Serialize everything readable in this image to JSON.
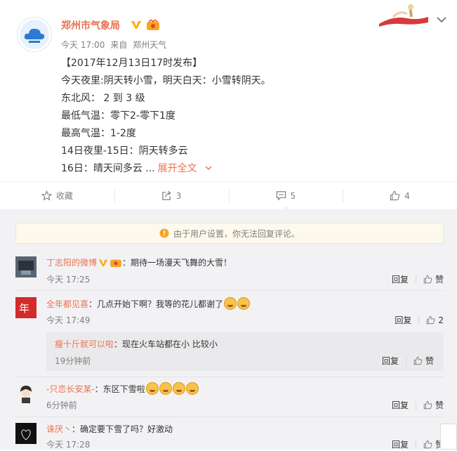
{
  "post": {
    "author": "郑州市气象局",
    "time": "今天 17:00",
    "from_label": "来自",
    "source": "郑州天气",
    "lines": [
      "【2017年12月13日17时发布】",
      "今天夜里:阴天转小雪，明天白天：小雪转阴天。",
      "东北风： 2 到 3 级",
      "最低气温：零下2-零下1度",
      "最高气温：1-2度",
      "14日夜里-15日：阴天转多云",
      "16日：晴天间多云 ..."
    ],
    "expand_label": "展开全文"
  },
  "actions": {
    "favorite": "收藏",
    "repost_count": "3",
    "comment_count": "5",
    "like_count": "4"
  },
  "comments_notice": "由于用户设置，你无法回复评论。",
  "comments": [
    {
      "user": "丁志阳的微博",
      "text": "：期待一场漫天飞舞的大雪！",
      "time": "今天 17:25",
      "reply": "回复",
      "like": "赞"
    },
    {
      "user": "全年都见喜",
      "text": "：几点开始下啊？我等的花儿都谢了",
      "time": "今天 17:49",
      "reply": "回复",
      "like": "2"
    },
    {
      "user": "-只恋长安某-",
      "text": "：东区下雪啦",
      "time": "6分钟前",
      "reply": "回复",
      "like": "赞"
    },
    {
      "user": "诛厌丶",
      "text": "：确定要下雪了吗？好激动",
      "time": "今天 17:28",
      "reply": "回复",
      "like": "赞"
    }
  ],
  "sub_reply": {
    "user": "瘦十斤就可以啦",
    "text": "：现在火车站都在小  比较小",
    "time": "19分钟前",
    "reply": "回复",
    "like": "赞"
  },
  "colors": {
    "accent": "#eb7350",
    "vip": "#f6a623",
    "verified": "#ffa800"
  }
}
